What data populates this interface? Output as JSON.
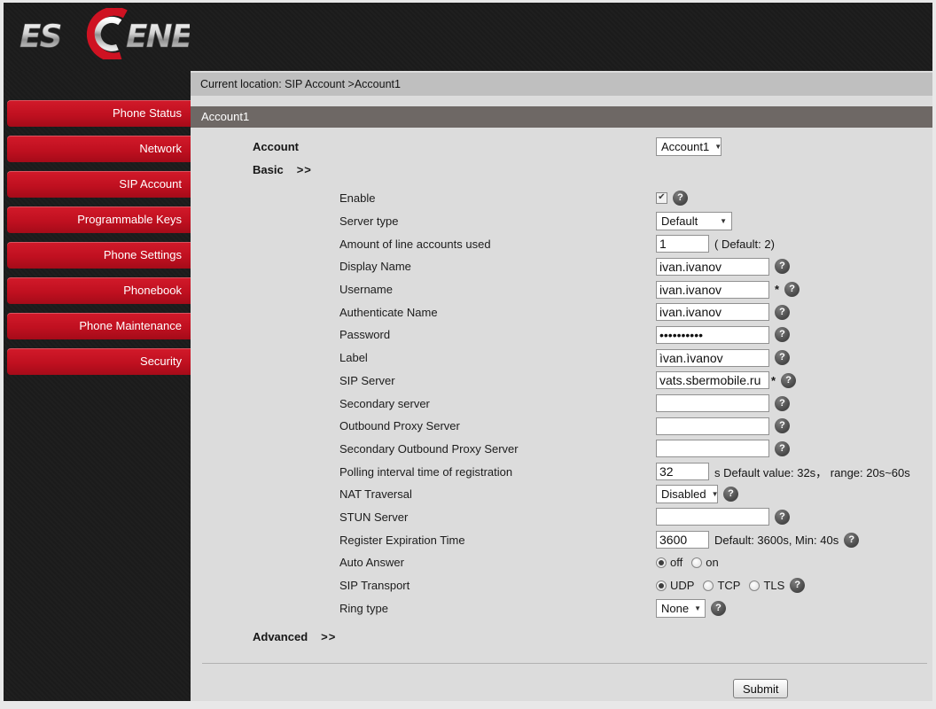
{
  "colors": {
    "accent_red": "#c01020",
    "sidebar_bg": "#1b1b1b",
    "content_bg": "#dcdcdc",
    "breadcrumb_bar": "#bfbfbf",
    "section_header_bar": "#6e6865"
  },
  "logo": {
    "brand": "ESCENE",
    "left_letters": "ES",
    "right_letters": "ENE"
  },
  "sidebar": {
    "items": [
      "Phone Status",
      "Network",
      "SIP Account",
      "Programmable Keys",
      "Phone Settings",
      "Phonebook",
      "Phone Maintenance",
      "Security"
    ]
  },
  "breadcrumb": "Current location: SIP Account >Account1",
  "section_header": "Account1",
  "account": {
    "label": "Account",
    "selected": "Account1"
  },
  "basic": {
    "label": "Basic",
    "expander": ">>"
  },
  "advanced": {
    "label": "Advanced",
    "expander": ">>"
  },
  "fields": {
    "enable": {
      "label": "Enable",
      "checked": true
    },
    "server_type": {
      "label": "Server type",
      "value": "Default"
    },
    "line_accounts": {
      "label": "Amount of line accounts used",
      "value": "1",
      "hint": "( Default: 2)"
    },
    "display_name": {
      "label": "Display Name",
      "value": "ivan.ivanov"
    },
    "username": {
      "label": "Username",
      "value": "ivan.ivanov",
      "required_mark": "*"
    },
    "auth_name": {
      "label": "Authenticate Name",
      "value": "ivan.ivanov"
    },
    "password": {
      "label": "Password",
      "value": "••••••••••"
    },
    "label_field": {
      "label": "Label",
      "value": "ìvan.ìvanov"
    },
    "sip_server": {
      "label": "SIP Server",
      "value": "vats.sbermobile.ru",
      "required_mark": "*"
    },
    "secondary_server": {
      "label": "Secondary server",
      "value": ""
    },
    "outbound_proxy": {
      "label": "Outbound Proxy Server",
      "value": ""
    },
    "secondary_outbound_proxy": {
      "label": "Secondary Outbound Proxy Server",
      "value": ""
    },
    "polling_interval": {
      "label": "Polling interval time of registration",
      "value": "32",
      "hint": "s Default value: 32s， range: 20s~60s"
    },
    "nat_traversal": {
      "label": "NAT Traversal",
      "value": "Disabled"
    },
    "stun_server": {
      "label": "STUN Server",
      "value": ""
    },
    "register_expiration": {
      "label": "Register Expiration Time",
      "value": "3600",
      "hint": "Default: 3600s, Min: 40s"
    },
    "auto_answer": {
      "label": "Auto Answer",
      "options": [
        "off",
        "on"
      ],
      "selected": "off"
    },
    "sip_transport": {
      "label": "SIP Transport",
      "options": [
        "UDP",
        "TCP",
        "TLS"
      ],
      "selected": "UDP"
    },
    "ring_type": {
      "label": "Ring type",
      "value": "None"
    }
  },
  "submit_label": "Submit",
  "icons": {
    "help": "?",
    "dropdown": "▼",
    "check": "✔"
  }
}
